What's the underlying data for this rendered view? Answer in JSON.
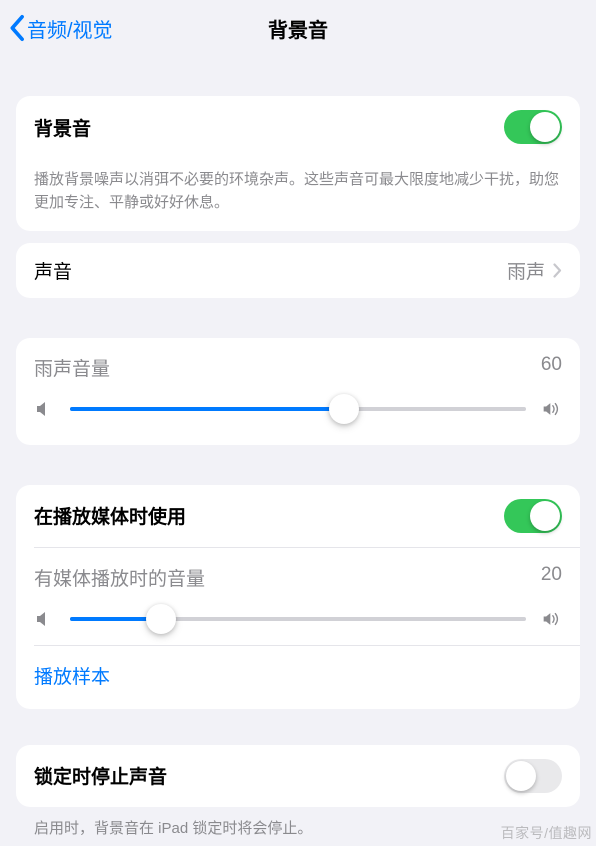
{
  "nav": {
    "back_label": "音频/视觉",
    "title": "背景音"
  },
  "main_toggle": {
    "label": "背景音",
    "on": true,
    "description": "播放背景噪声以消弭不必要的环境杂声。这些声音可最大限度地减少干扰，助您更加专注、平静或好好休息。"
  },
  "sound_row": {
    "label": "声音",
    "value": "雨声"
  },
  "volume1": {
    "label": "雨声音量",
    "value": 60
  },
  "media": {
    "toggle_label": "在播放媒体时使用",
    "toggle_on": true,
    "volume_label": "有媒体播放时的音量",
    "volume_value": 20,
    "sample_link": "播放样本"
  },
  "lock": {
    "label": "锁定时停止声音",
    "on": false,
    "description": "启用时，背景音在 iPad 锁定时将会停止。"
  },
  "watermark": "百家号/值趣网"
}
